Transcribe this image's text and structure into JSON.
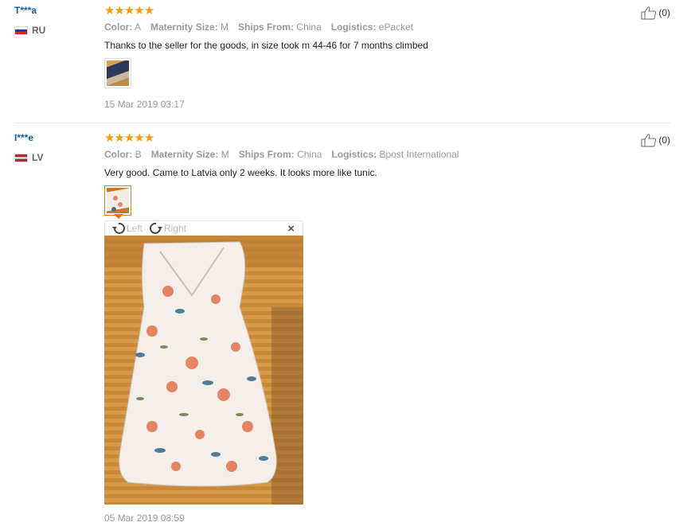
{
  "reviews": [
    {
      "user": "T***a",
      "country": "RU",
      "attrs": [
        {
          "label": "Color:",
          "value": "A"
        },
        {
          "label": "Maternity Size:",
          "value": "M"
        },
        {
          "label": "Ships From:",
          "value": "China"
        },
        {
          "label": "Logistics:",
          "value": "ePacket"
        }
      ],
      "feedback": "Thanks to the seller for the goods, in size took m 44-46 for 7 months climbed",
      "date": "15 Mar 2019 03:17",
      "likes": "(0)",
      "rating": 5
    },
    {
      "user": "I***e",
      "country": "LV",
      "attrs": [
        {
          "label": "Color:",
          "value": "B"
        },
        {
          "label": "Maternity Size:",
          "value": "M"
        },
        {
          "label": "Ships From:",
          "value": "China"
        },
        {
          "label": "Logistics:",
          "value": "Bpost International"
        }
      ],
      "feedback": "Very good. Came to Latvia only 2 weeks. It looks more like tunic.",
      "date": "05 Mar 2019 08:59",
      "likes": "(0)",
      "rating": 5
    }
  ],
  "viewer": {
    "rotate_left": "Left",
    "rotate_right": "Right",
    "close": "×"
  },
  "icons": {
    "star": "star-icon",
    "like": "thumbs-up-icon",
    "rotate_left": "rotate-left-icon",
    "rotate_right": "rotate-right-icon"
  },
  "colors": {
    "username": "#0a5fb4",
    "star": "#ff9a0a",
    "active_thumb": "#e07a18"
  }
}
